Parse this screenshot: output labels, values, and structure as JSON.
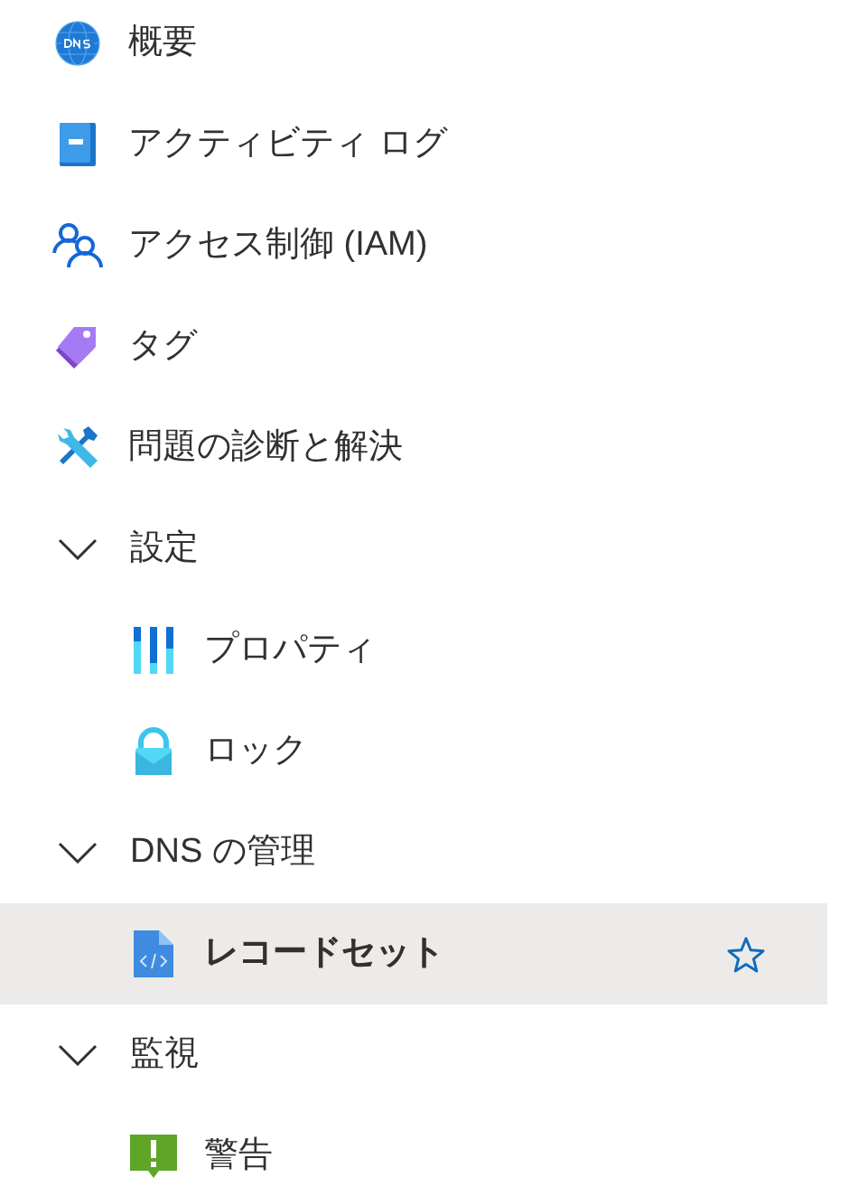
{
  "menu": [
    {
      "label": "概要",
      "selected": false
    },
    {
      "label": "アクティビティ ログ",
      "selected": false
    },
    {
      "label": "アクセス制御 (IAM)",
      "selected": false
    },
    {
      "label": "タグ",
      "selected": false
    },
    {
      "label": "問題の診断と解決",
      "selected": false
    },
    {
      "label": "設定",
      "expanded": true,
      "children": [
        {
          "label": "プロパティ",
          "selected": false
        },
        {
          "label": "ロック",
          "selected": false
        }
      ]
    },
    {
      "label": "DNS の管理",
      "expanded": true,
      "children": [
        {
          "label": "レコードセット",
          "selected": true
        }
      ]
    },
    {
      "label": "監視",
      "expanded": true,
      "children": [
        {
          "label": "警告",
          "selected": false
        }
      ]
    }
  ]
}
